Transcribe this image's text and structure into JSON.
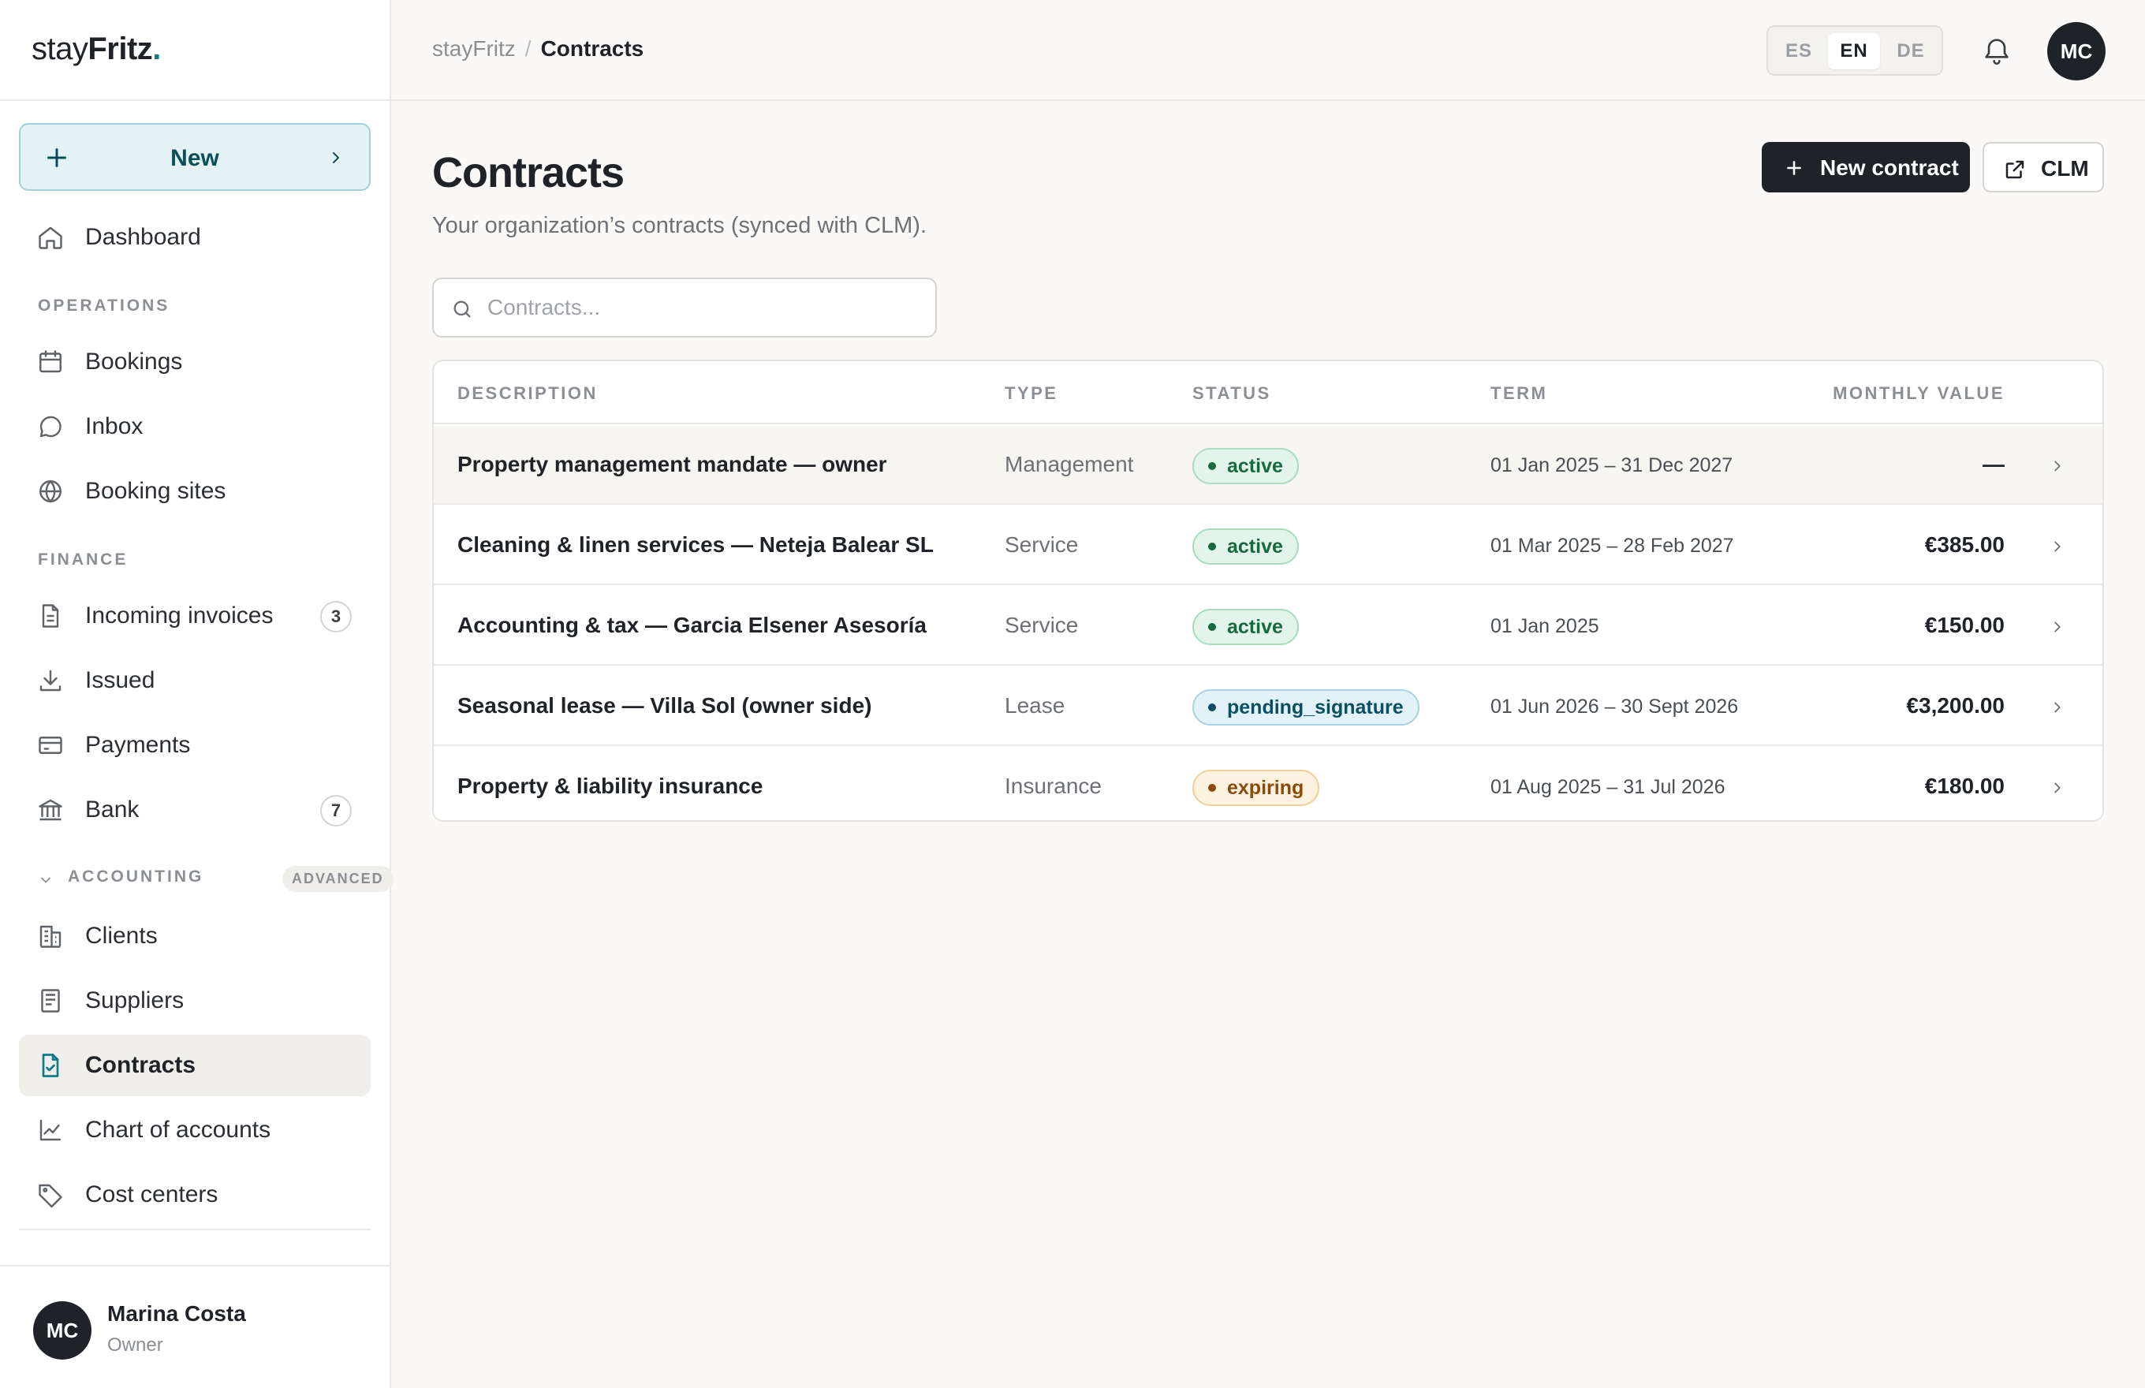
{
  "brand": {
    "light": "stay",
    "bold": "Fritz",
    "dot": "."
  },
  "sidebar": {
    "new_label": "New",
    "dashboard": "Dashboard",
    "sections": {
      "operations": "OPERATIONS",
      "finance": "FINANCE",
      "accounting": "ACCOUNTING",
      "advanced": "ADVANCED"
    },
    "operations": [
      {
        "label": "Bookings",
        "icon": "calendar-icon"
      },
      {
        "label": "Inbox",
        "icon": "chat-bubble-icon"
      },
      {
        "label": "Booking sites",
        "icon": "globe-icon"
      }
    ],
    "finance": [
      {
        "label": "Incoming invoices",
        "icon": "document-icon",
        "badge": "3"
      },
      {
        "label": "Issued",
        "icon": "download-icon"
      },
      {
        "label": "Payments",
        "icon": "credit-card-icon"
      },
      {
        "label": "Bank",
        "icon": "bank-icon",
        "badge": "7"
      }
    ],
    "accounting": [
      {
        "label": "Clients",
        "icon": "building-icon"
      },
      {
        "label": "Suppliers",
        "icon": "receipt-icon"
      },
      {
        "label": "Contracts",
        "icon": "contract-icon",
        "active": true
      },
      {
        "label": "Chart of accounts",
        "icon": "line-chart-icon"
      },
      {
        "label": "Cost centers",
        "icon": "tag-icon"
      }
    ],
    "user": {
      "initials": "MC",
      "name": "Marina Costa",
      "role": "Owner"
    }
  },
  "topbar": {
    "breadcrumb": {
      "root": "stayFritz",
      "separator": "/",
      "current": "Contracts"
    },
    "languages": [
      "ES",
      "EN",
      "DE"
    ],
    "active_language": "EN",
    "avatar_initials": "MC"
  },
  "main": {
    "title": "Contracts",
    "subtitle": "Your organization’s contracts (synced with CLM).",
    "new_contract_label": "New contract",
    "clm_label": "CLM",
    "search_placeholder": "Contracts...",
    "search_value": "",
    "columns": {
      "description": "DESCRIPTION",
      "type": "TYPE",
      "status": "STATUS",
      "term": "TERM",
      "value": "MONTHLY VALUE"
    },
    "rows": [
      {
        "description": "Property management mandate — owner",
        "type": "Management",
        "status": "active",
        "status_kind": "active",
        "term": "01 Jan 2025 – 31 Dec 2027",
        "value": "—"
      },
      {
        "description": "Cleaning & linen services — Neteja Balear SL",
        "type": "Service",
        "status": "active",
        "status_kind": "active",
        "term": "01 Mar 2025 – 28 Feb 2027",
        "value": "€385.00"
      },
      {
        "description": "Accounting & tax — Garcia Elsener Asesoría",
        "type": "Service",
        "status": "active",
        "status_kind": "active",
        "term": "01 Jan 2025",
        "value": "€150.00"
      },
      {
        "description": "Seasonal lease — Villa Sol (owner side)",
        "type": "Lease",
        "status": "pending_signature",
        "status_kind": "pending",
        "term": "01 Jun 2026 – 30 Sept 2026",
        "value": "€3,200.00"
      },
      {
        "description": "Property & liability insurance",
        "type": "Insurance",
        "status": "expiring",
        "status_kind": "expiring",
        "term": "01 Aug 2025 – 31 Jul 2026",
        "value": "€180.00"
      }
    ]
  },
  "colors": {
    "accent": "#0e7c86",
    "primary_button": "#1f2328",
    "status_active": "#166a3d",
    "status_pending": "#0b4f63",
    "status_expiring": "#8a4c0a"
  }
}
